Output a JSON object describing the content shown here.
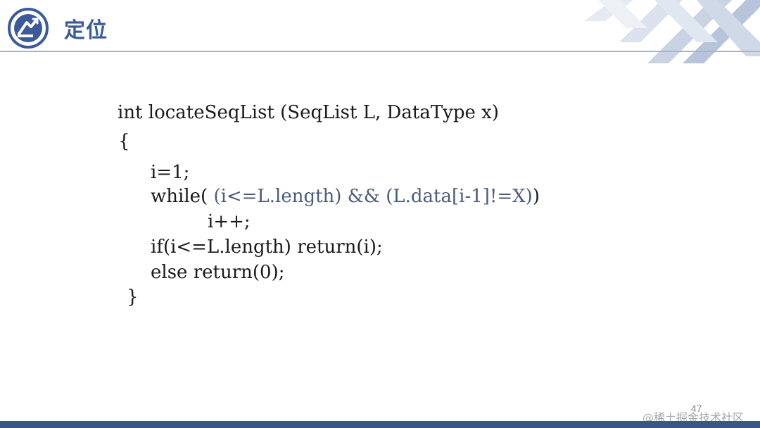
{
  "slide": {
    "title": "定位",
    "page_number": "47",
    "watermark": "@稀土掘金技术社区"
  },
  "code": {
    "signature": "int locateSeqList (SeqList L, DataType x)",
    "open_brace": "{",
    "line_init": "i=1;",
    "line_while_kw": "while( ",
    "line_while_cond": "(i<=L.length) && (L.data[i-1]!=X)",
    "line_while_close": ")",
    "line_incr": "i++;",
    "line_if": "if(i<=L.length) return(i);",
    "line_else": "else return(0);",
    "close_brace": "}"
  },
  "colors": {
    "title": "#3b5a9a",
    "footer_bar": "#3a5589",
    "code_text": "#1a1a1a",
    "code_muted": "#4c5c7a"
  },
  "icons": {
    "logo": "circular-arrow-badge-icon",
    "decoration": "diagonal-stripes-decoration"
  }
}
